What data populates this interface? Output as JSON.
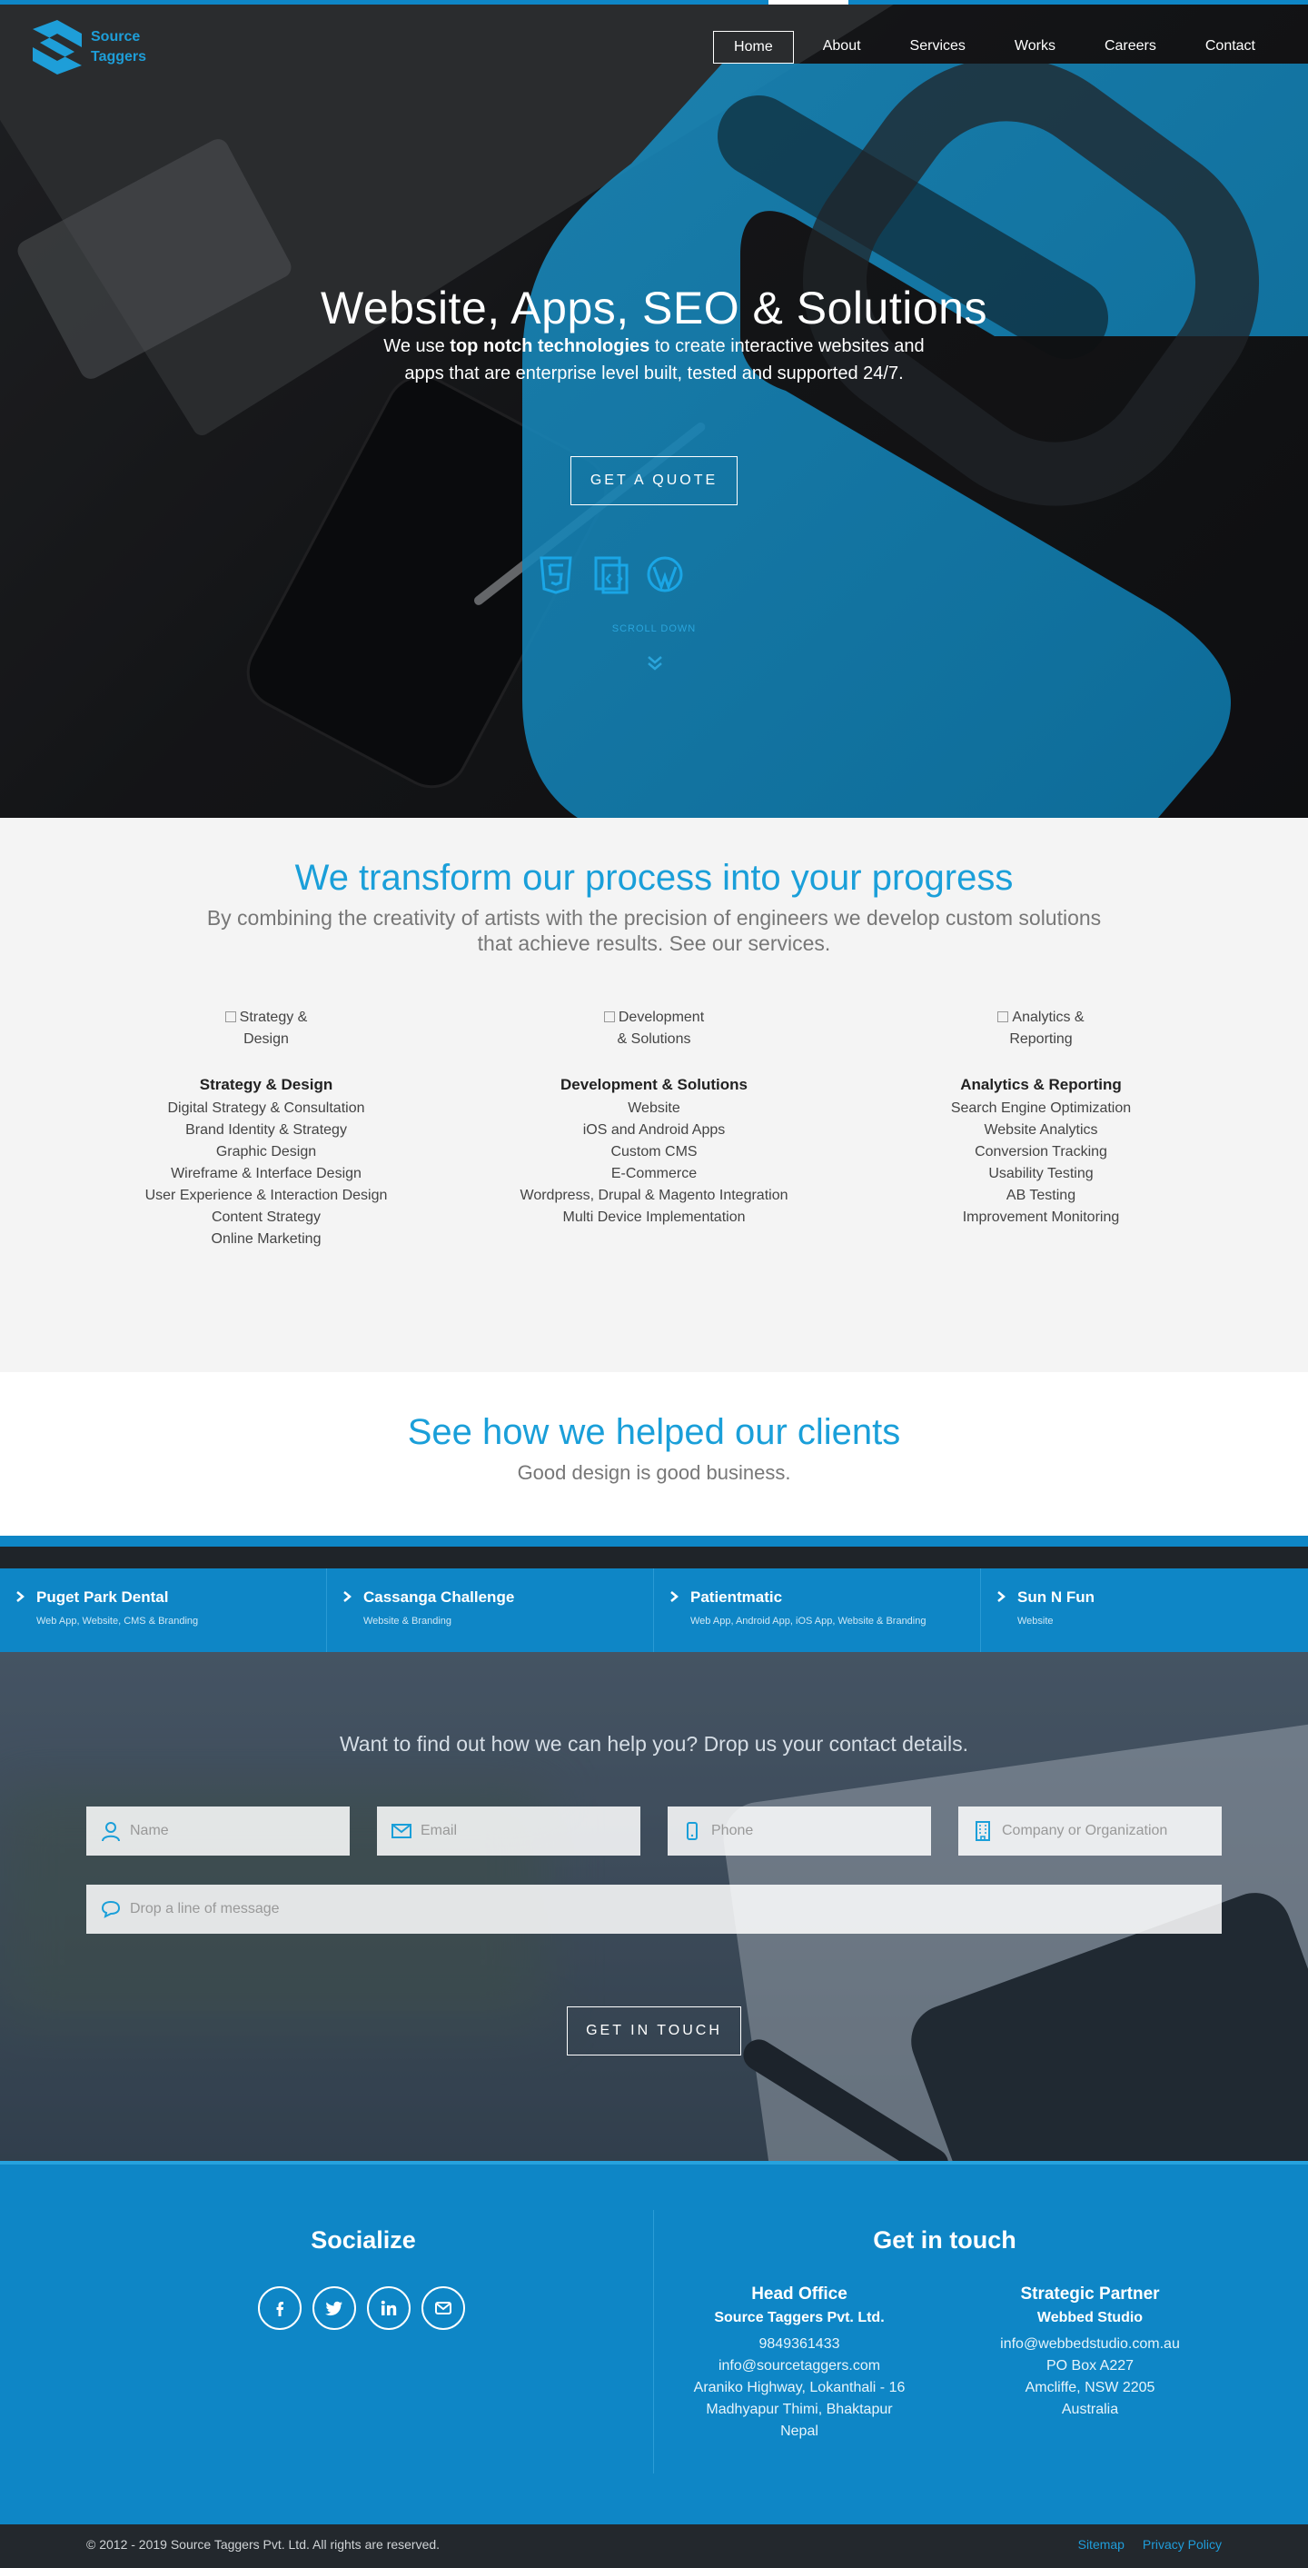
{
  "brand": {
    "line1": "Source",
    "line2": "Taggers",
    "accent": "#0e86c6"
  },
  "nav": [
    "Home",
    "About",
    "Services",
    "Works",
    "Careers",
    "Contact"
  ],
  "hero": {
    "title": "Website, Apps, SEO & Solutions",
    "sub_pre": "We use ",
    "sub_bold": "top notch technologies",
    "sub_post": " to create interactive websites and apps that are enterprise level built, tested and supported 24/7.",
    "cta": "GET A QUOTE",
    "tech_icons": [
      "html5-icon",
      "css3-icon",
      "wordpress-icon"
    ],
    "scroll_label": "SCROLL DOWN"
  },
  "services": {
    "title": "We transform our process into your progress",
    "subtitle": "By combining the creativity of artists with the precision of engineers we develop custom solutions that achieve results. See our services.",
    "columns": [
      {
        "img_alt": "Strategy & Design",
        "heading": "Strategy & Design",
        "items": [
          "Digital Strategy & Consultation",
          "Brand Identity & Strategy",
          "Graphic Design",
          "Wireframe & Interface Design",
          "User Experience & Interaction Design",
          "Content Strategy",
          "Online Marketing"
        ]
      },
      {
        "img_alt": "Development & Solutions",
        "heading": "Development & Solutions",
        "items": [
          "Website",
          "iOS and Android Apps",
          "Custom CMS",
          "E-Commerce",
          "Wordpress, Drupal & Magento Integration",
          "Multi Device Implementation"
        ]
      },
      {
        "img_alt": "Analytics & Reporting",
        "heading": "Analytics & Reporting",
        "items": [
          "Search Engine Optimization",
          "Website Analytics",
          "Conversion Tracking",
          "Usability Testing",
          "AB Testing",
          "Improvement Monitoring"
        ]
      }
    ]
  },
  "clients": {
    "title": "See how we helped our clients",
    "subtitle": "Good design is good business.",
    "items": [
      {
        "name": "Puget Park Dental",
        "tags": "Web App, Website, CMS & Branding"
      },
      {
        "name": "Cassanga Challenge",
        "tags": "Website & Branding"
      },
      {
        "name": "Patientmatic",
        "tags": "Web App, Android App, iOS App, Website & Branding"
      },
      {
        "name": "Sun N Fun",
        "tags": "Website"
      }
    ]
  },
  "contact": {
    "title": "Want to find out how we can help you? Drop us your contact details.",
    "placeholders": {
      "name": "Name",
      "email": "Email",
      "phone": "Phone",
      "company": "Company or Organization",
      "message": "Drop a line of message"
    },
    "submit": "GET IN TOUCH"
  },
  "footer": {
    "socialize": "Socialize",
    "social_icons": [
      "facebook-icon",
      "twitter-icon",
      "linkedin-icon",
      "email-icon"
    ],
    "get_in_touch": "Get in touch",
    "head_office": {
      "heading": "Head Office",
      "company": "Source Taggers Pvt. Ltd.",
      "lines": [
        "9849361433",
        "info@sourcetaggers.com",
        "Araniko Highway, Lokanthali - 16",
        "Madhyapur Thimi, Bhaktapur",
        "Nepal"
      ]
    },
    "partner": {
      "heading": "Strategic Partner",
      "company": "Webbed Studio",
      "lines": [
        "info@webbedstudio.com.au",
        "PO Box A227",
        "Amcliffe, NSW 2205",
        "Australia"
      ]
    },
    "copyright": "© 2012 - 2019 Source Taggers Pvt. Ltd. All rights are reserved.",
    "links": [
      "Sitemap",
      "Privacy Policy"
    ]
  }
}
